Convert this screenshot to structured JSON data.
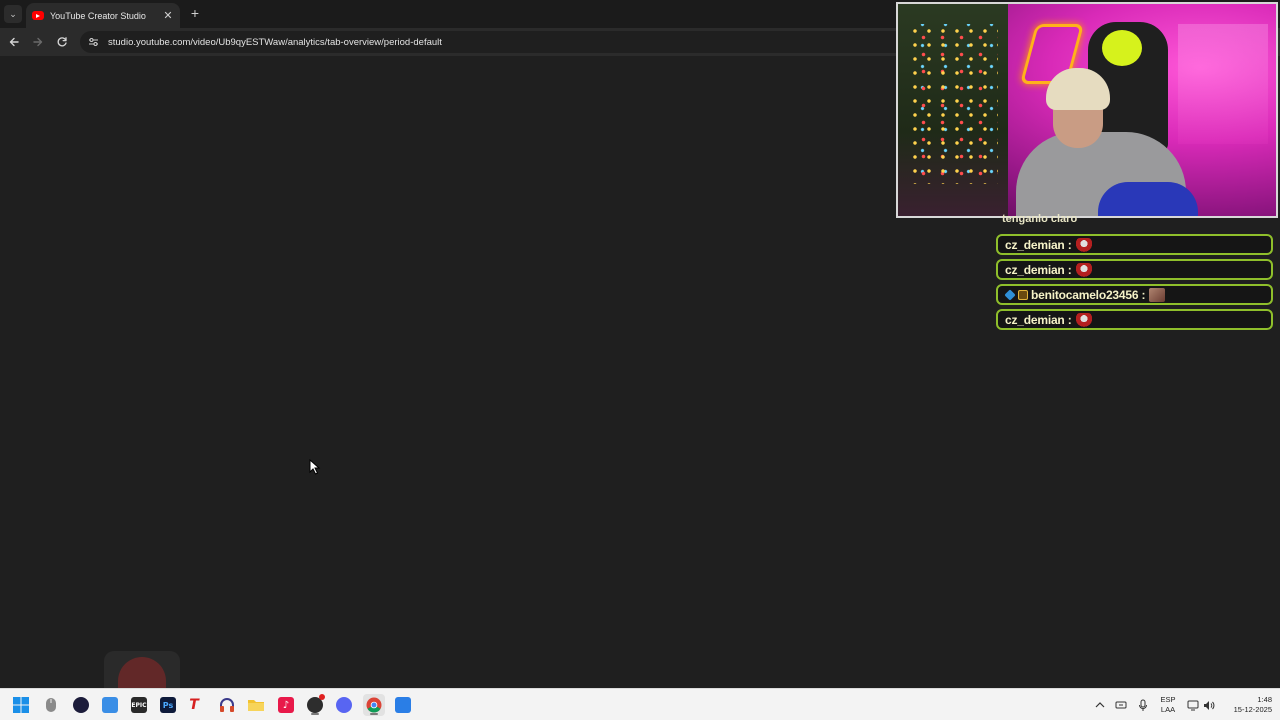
{
  "browser": {
    "tab": {
      "title": "YouTube Creator Studio",
      "favicon": "youtube-icon",
      "close_glyph": "✕"
    },
    "new_tab_glyph": "+",
    "tab_menu_glyph": "⌄",
    "url": "studio.youtube.com/video/Ub9qyESTWaw/analytics/tab-overview/period-default",
    "colors": {
      "tabstrip": "#1b1b1b",
      "toolbar": "#2b2b2b",
      "page_background": "#1f1f1f"
    }
  },
  "stream_overlay": {
    "webcam": {
      "description_icon": "webcam-feed"
    },
    "chat": {
      "partial_message": "tenganlo claro",
      "messages": [
        {
          "user": "cz_demian :",
          "badges": [],
          "emote": "emote"
        },
        {
          "user": "cz_demian :",
          "badges": [],
          "emote": "emote"
        },
        {
          "user": "benitocamelo23456 :",
          "badges": [
            "blue-gem-badge",
            "crown-badge"
          ],
          "emote": "image-emote"
        },
        {
          "user": "cz_demian :",
          "badges": [],
          "emote": "emote"
        }
      ],
      "colors": {
        "border": "#8fbf2b",
        "text": "#f5f2c8",
        "background": "#151515"
      }
    }
  },
  "taskbar": {
    "apps": [
      {
        "name": "start-menu"
      },
      {
        "name": "mouse-app"
      },
      {
        "name": "media-app"
      },
      {
        "name": "notepad-app"
      },
      {
        "name": "epic-games-launcher",
        "label": "EPIC"
      },
      {
        "name": "photoshop",
        "label": "Ps"
      },
      {
        "name": "text-app",
        "label": "T"
      },
      {
        "name": "headphones-app"
      },
      {
        "name": "file-explorer"
      },
      {
        "name": "tiktok"
      },
      {
        "name": "obs-studio"
      },
      {
        "name": "discord"
      },
      {
        "name": "chrome"
      },
      {
        "name": "blue-app"
      }
    ],
    "tray": {
      "language_line1": "ESP",
      "language_line2": "LAA",
      "time": "1:48",
      "date": "15-12-2025"
    },
    "colors": {
      "background": "#f3f3f3"
    }
  }
}
